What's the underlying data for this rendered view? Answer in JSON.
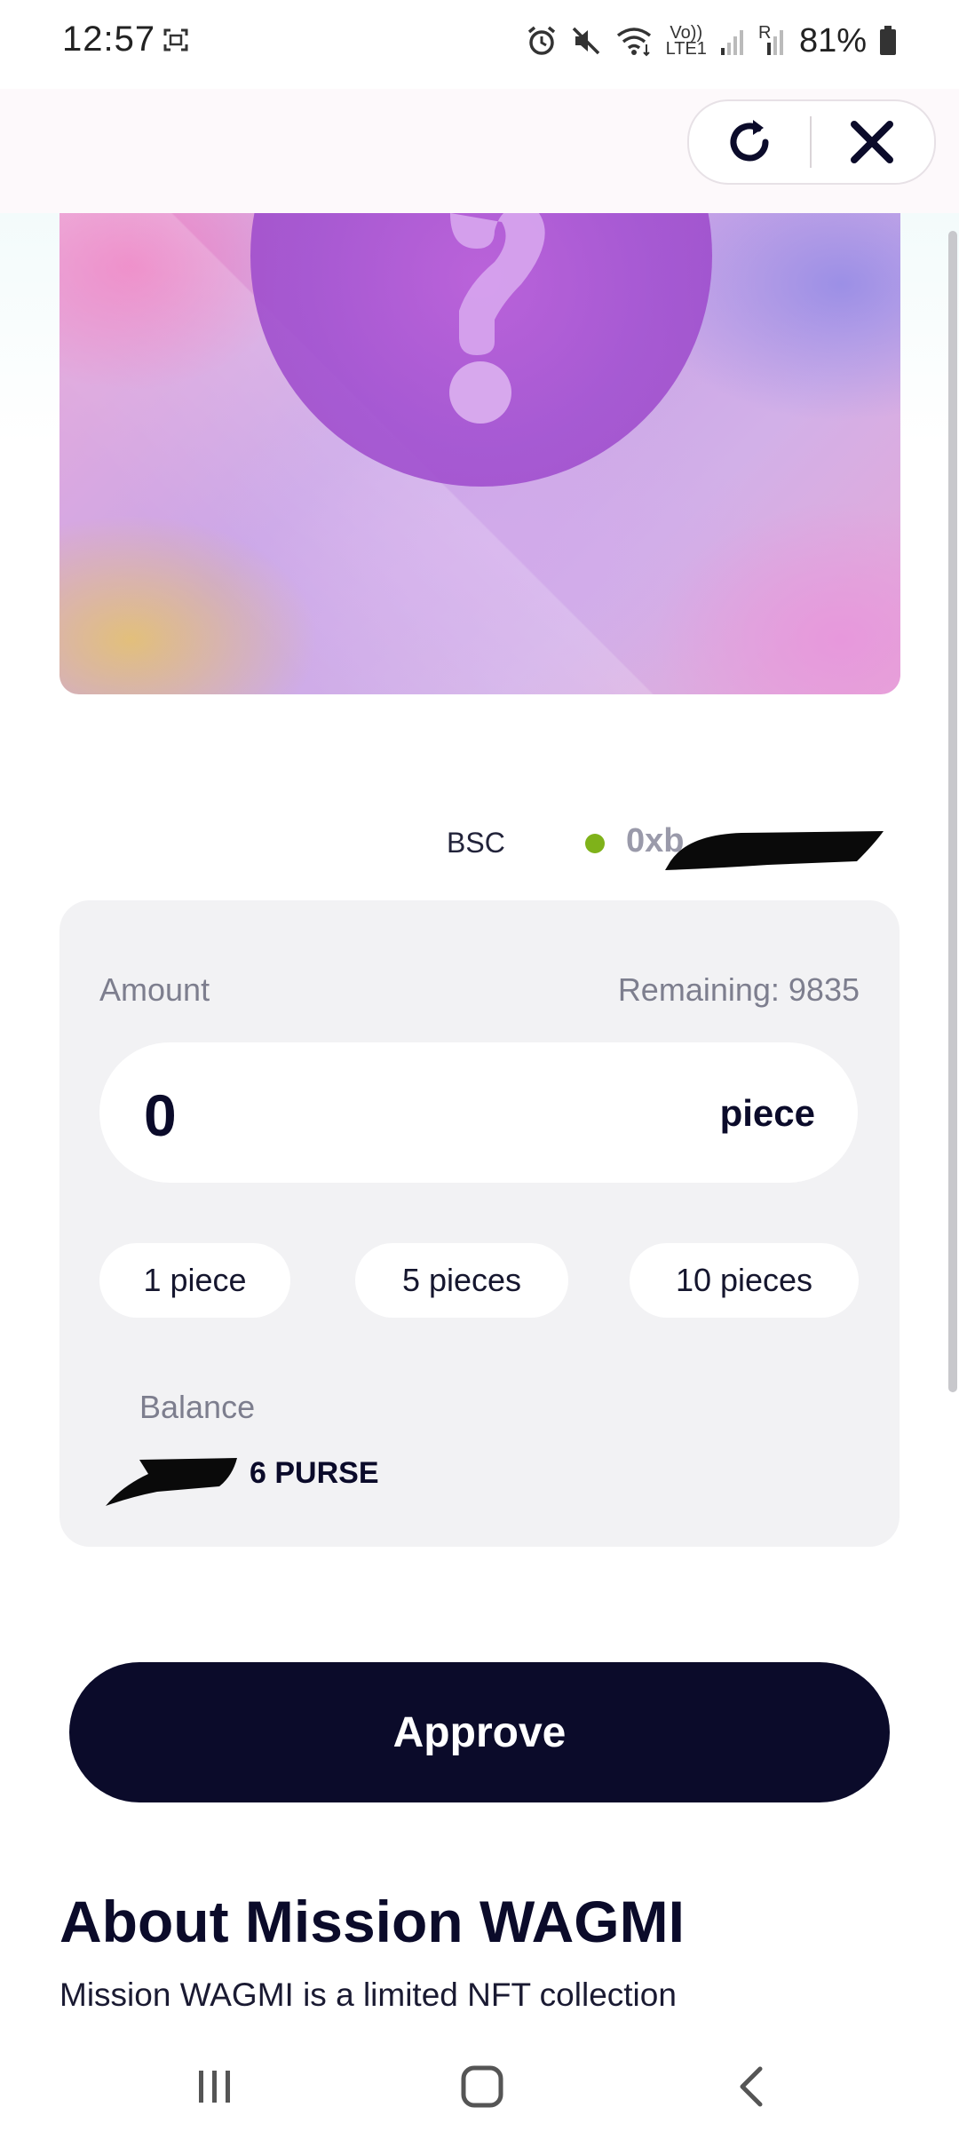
{
  "status_bar": {
    "time": "12:57",
    "network_top": "Vo))",
    "network_bottom": "LTE1",
    "sim_label": "R",
    "battery": "81%"
  },
  "header": {
    "reload_icon": "reload-icon",
    "close_icon": "close-icon"
  },
  "hero": {
    "icon": "question-mark-icon"
  },
  "wallet": {
    "network": "BSC",
    "address": "0xb",
    "status_color": "#7fb21a"
  },
  "purchase": {
    "amount_label": "Amount",
    "remaining_label": "Remaining: 9835",
    "amount_value": "0",
    "unit": "piece",
    "quick_amounts": [
      "1 piece",
      "5 pieces",
      "10 pieces"
    ],
    "balance_label": "Balance",
    "balance_value": "6 PURSE"
  },
  "approve_button": {
    "label": "Approve",
    "color": "#0b0b2a"
  },
  "about": {
    "title": "About Mission WAGMI",
    "text": "Mission WAGMI is a limited NFT collection"
  },
  "nav_bar": {
    "recent_icon": "recent-apps-icon",
    "home_icon": "home-icon",
    "back_icon": "back-icon"
  }
}
